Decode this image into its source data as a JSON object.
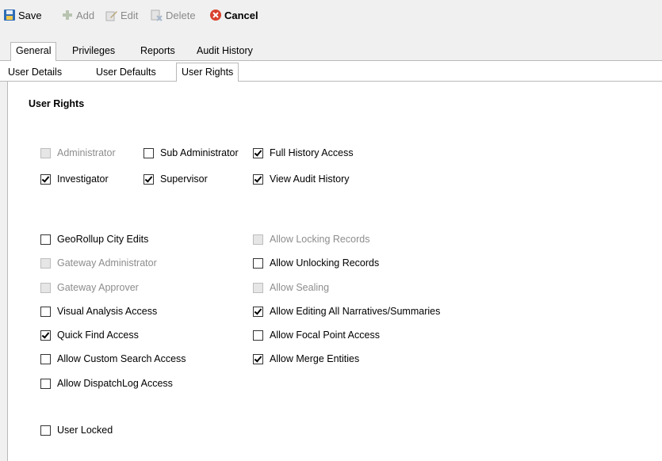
{
  "toolbar": {
    "save": "Save",
    "add": "Add",
    "edit": "Edit",
    "delete": "Delete",
    "cancel": "Cancel"
  },
  "main_tabs": [
    "General",
    "Privileges",
    "Reports",
    "Audit History"
  ],
  "sub_tabs": [
    "User Details",
    "User Defaults",
    "User Rights"
  ],
  "section_title": "User Rights",
  "rights": {
    "administrator": {
      "label": "Administrator",
      "checked": false,
      "enabled": false
    },
    "sub_administrator": {
      "label": "Sub Administrator",
      "checked": false,
      "enabled": true
    },
    "full_history_access": {
      "label": "Full History Access",
      "checked": true,
      "enabled": true
    },
    "investigator": {
      "label": "Investigator",
      "checked": true,
      "enabled": true
    },
    "supervisor": {
      "label": "Supervisor",
      "checked": true,
      "enabled": true
    },
    "view_audit_history": {
      "label": "View Audit History",
      "checked": true,
      "enabled": true
    },
    "georollup_city_edits": {
      "label": "GeoRollup City Edits",
      "checked": false,
      "enabled": true
    },
    "gateway_administrator": {
      "label": "Gateway Administrator",
      "checked": false,
      "enabled": false
    },
    "gateway_approver": {
      "label": "Gateway Approver",
      "checked": false,
      "enabled": false
    },
    "visual_analysis_access": {
      "label": "Visual Analysis Access",
      "checked": false,
      "enabled": true
    },
    "quick_find_access": {
      "label": "Quick Find Access",
      "checked": true,
      "enabled": true
    },
    "allow_custom_search_access": {
      "label": "Allow Custom Search Access",
      "checked": false,
      "enabled": true
    },
    "allow_dispatchlog_access": {
      "label": "Allow DispatchLog Access",
      "checked": false,
      "enabled": true
    },
    "user_locked": {
      "label": "User Locked",
      "checked": false,
      "enabled": true
    },
    "allow_locking_records": {
      "label": "Allow Locking Records",
      "checked": false,
      "enabled": false
    },
    "allow_unlocking_records": {
      "label": "Allow Unlocking Records",
      "checked": false,
      "enabled": true
    },
    "allow_sealing": {
      "label": "Allow Sealing",
      "checked": false,
      "enabled": false
    },
    "allow_editing_all_narratives": {
      "label": "Allow Editing All Narratives/Summaries",
      "checked": true,
      "enabled": true
    },
    "allow_focal_point_access": {
      "label": "Allow Focal Point Access",
      "checked": false,
      "enabled": true
    },
    "allow_merge_entities": {
      "label": "Allow Merge Entities",
      "checked": true,
      "enabled": true
    }
  }
}
